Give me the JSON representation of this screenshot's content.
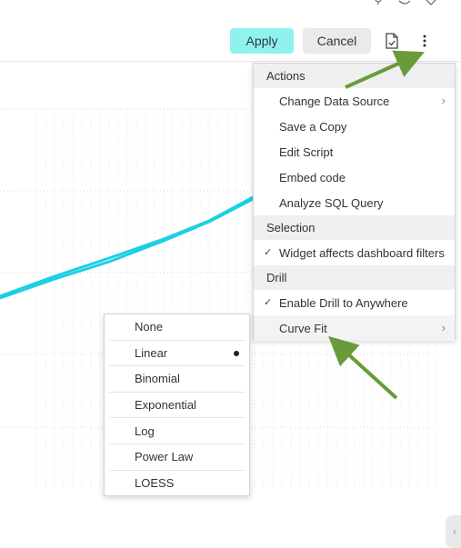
{
  "toolbar": {
    "apply_label": "Apply",
    "cancel_label": "Cancel",
    "export_icon": "file-export-icon",
    "more_icon": "vertical-ellipsis-icon"
  },
  "actions_menu": {
    "sections": [
      {
        "header": "Actions",
        "items": [
          {
            "label": "Change Data Source",
            "submenu": true
          },
          {
            "label": "Save a Copy"
          },
          {
            "label": "Edit Script"
          },
          {
            "label": "Embed code"
          },
          {
            "label": "Analyze SQL Query"
          }
        ]
      },
      {
        "header": "Selection",
        "items": [
          {
            "label": "Widget affects dashboard filters",
            "checked": true
          }
        ]
      },
      {
        "header": "Drill",
        "items": [
          {
            "label": "Enable Drill to Anywhere",
            "checked": true
          },
          {
            "label": "Curve Fit",
            "submenu": true
          }
        ]
      }
    ]
  },
  "curve_fit_menu": {
    "options": [
      "None",
      "Linear",
      "Binomial",
      "Exponential",
      "Log",
      "Power Law",
      "LOESS"
    ],
    "selected": "Linear"
  },
  "colors": {
    "series": "#1ccfe3",
    "apply_bg": "#8ff2ee",
    "annotation_arrow": "#6a9a3a"
  }
}
